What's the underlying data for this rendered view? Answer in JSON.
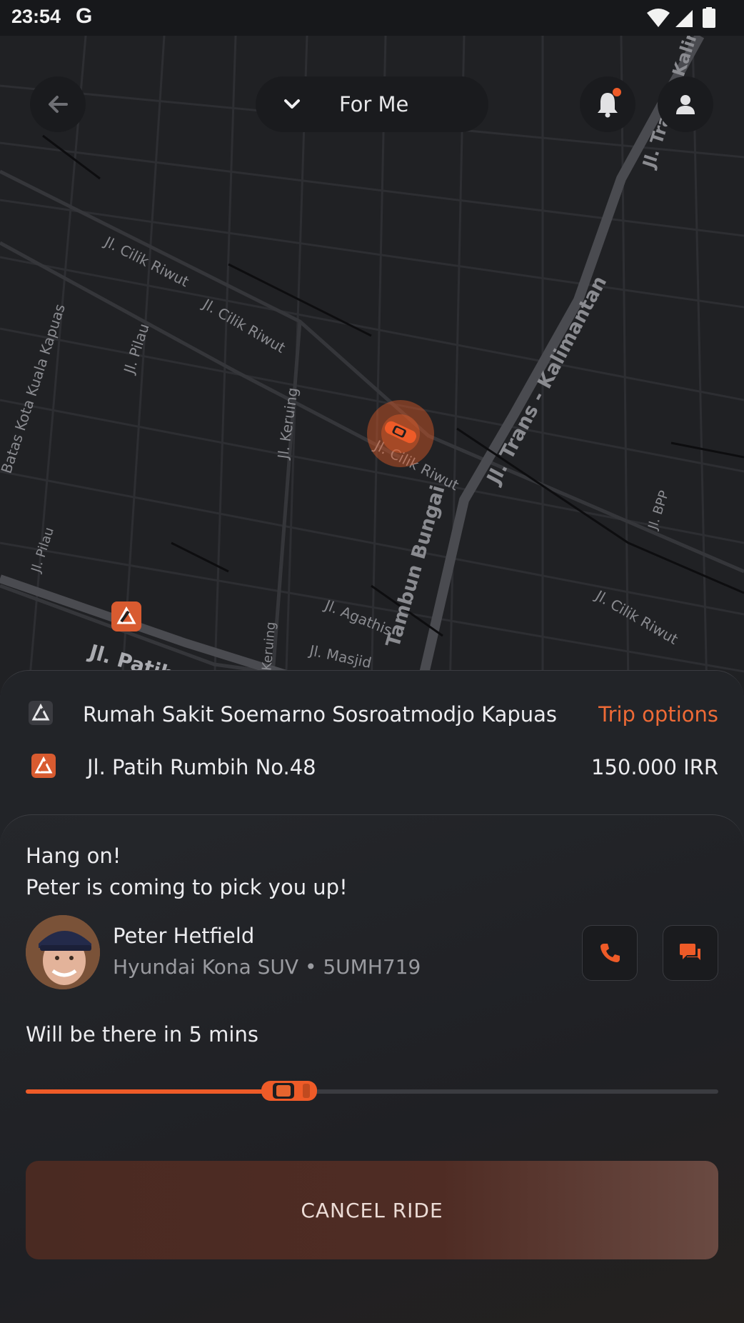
{
  "status_bar": {
    "time": "23:54",
    "google_letter": "G",
    "icons": [
      "wifi-icon",
      "signal-icon",
      "battery-icon"
    ]
  },
  "top_bar": {
    "passenger_selector": "For Me",
    "icons": [
      "back-arrow-icon",
      "chevron-down-icon",
      "bell-icon",
      "user-icon"
    ]
  },
  "map": {
    "streets": [
      "Jl. Cilik Riwut",
      "Jl. Cilik Riwut",
      "Jl. Pilau",
      "Batas Kota Kuala Kapuas",
      "Jl. Keruing",
      "Jl. Trans - Kalimantan",
      "Jl. Trans - Kalimantan",
      "Jl. Cilik Riwut",
      "Jl. BPP",
      "Jl. Pilau",
      "Jl. Agathis",
      "Tambun Bungai",
      "Jl. Cilik Riwut",
      "Jl. Patih Rumbih",
      "Jl. Keruing",
      "Jl. Masjid"
    ]
  },
  "trip": {
    "pickup": "Rumah Sakit Soemarno Sosroatmodjo Kapuas",
    "trip_options_label": "Trip options",
    "dropoff": "Jl. Patih Rumbih No.48",
    "price": "150.000 IRR"
  },
  "driver_panel": {
    "message_line1": "Hang on!",
    "message_line2": "Peter is coming to pick you up!",
    "driver_name": "Peter Hetfield",
    "vehicle": "Hyundai Kona SUV • 5UMH719",
    "eta": "Will be there in 5 mins",
    "progress": 0.38,
    "cancel_label": "CANCEL RIDE"
  },
  "colors": {
    "accent": "#ee5b28",
    "background": "#222428",
    "map": "#202124"
  }
}
